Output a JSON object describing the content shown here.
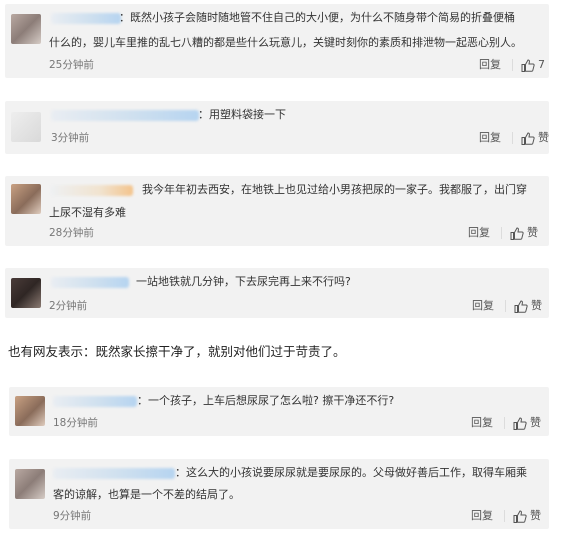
{
  "comments": [
    {
      "text_line1": "：既然小孩子会随时随地管不住自己的大小便，为什么不随身带个简易的折叠便桶",
      "text_line2": "什么的，婴儿车里推的乱七八糟的都是些什么玩意儿，关键时刻你的素质和排泄物一起恶心别人。",
      "time": "25分钟前",
      "reply": "回复",
      "like": "7"
    },
    {
      "text_line1": "：用塑料袋接一下",
      "time": "3分钟前",
      "reply": "回复",
      "like": "赞"
    },
    {
      "text_line1": "我今年年初去西安，在地铁上也见过给小男孩把尿的一家子。我都服了，出门穿",
      "text_line2": "上尿不湿有多难",
      "time": "28分钟前",
      "reply": "回复",
      "like": "赞"
    },
    {
      "text_line1": "一站地铁就几分钟，下去尿完再上来不行吗?",
      "time": "2分钟前",
      "reply": "回复",
      "like": "赞"
    },
    {
      "text_line1": "：一个孩子，上车后想尿尿了怎么啦? 擦干净还不行?",
      "time": "18分钟前",
      "reply": "回复",
      "like": "赞"
    },
    {
      "text_line1": "：这么大的小孩说要尿尿就是要尿尿的。父母做好善后工作，取得车厢乘",
      "text_line2": "客的谅解，也算是一个不差的结局了。",
      "time": "9分钟前",
      "reply": "回复",
      "like": "赞"
    }
  ],
  "caption": "也有网友表示：既然家长擦干净了，就别对他们过于苛责了。",
  "icons": {
    "like": "thumbs-up-icon",
    "avatar": "user-avatar"
  }
}
